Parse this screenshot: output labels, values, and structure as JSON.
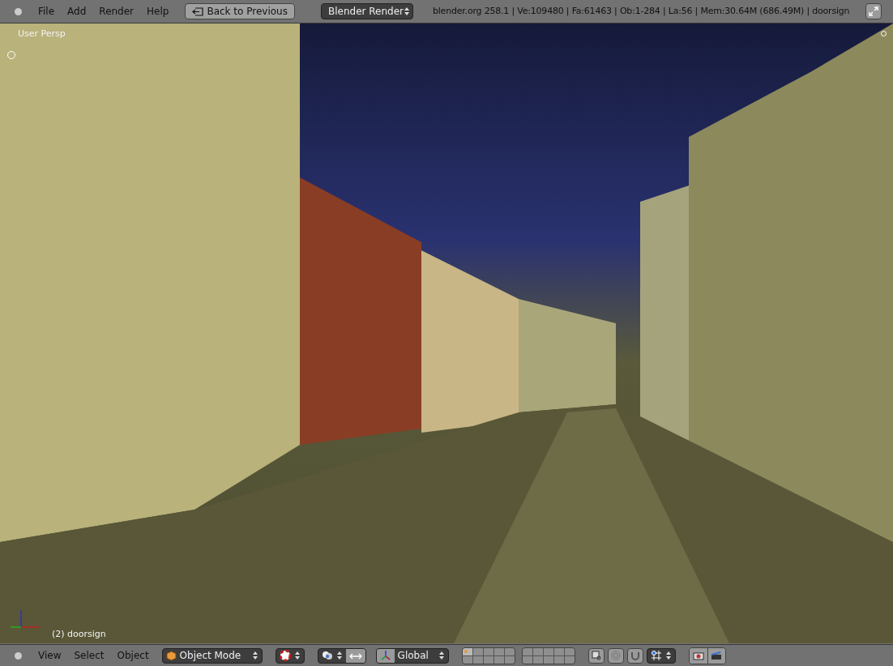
{
  "top_menu": [
    "File",
    "Add",
    "Render",
    "Help"
  ],
  "back_button": "Back to Previous",
  "render_engine": "Blender Render",
  "stats": "blender.org 258.1 | Ve:109480 | Fa:61463 | Ob:1-284 | La:56 | Mem:30.64M (686.49M) | doorsign",
  "viewport": {
    "view_name": "User Persp",
    "object_label": "(2) doorsign"
  },
  "bottom_menu": [
    "View",
    "Select",
    "Object"
  ],
  "mode": "Object Mode",
  "orientation": "Global",
  "layers": [
    {
      "selected": true
    },
    {
      "selected": false
    },
    {
      "selected": false
    },
    {
      "selected": false
    },
    {
      "selected": false
    },
    {
      "selected": false
    },
    {
      "selected": false
    },
    {
      "selected": false
    },
    {
      "selected": false
    },
    {
      "selected": false
    },
    {
      "selected": false
    },
    {
      "selected": false
    },
    {
      "selected": false
    },
    {
      "selected": false
    },
    {
      "selected": false
    },
    {
      "selected": false
    },
    {
      "selected": false
    },
    {
      "selected": false
    },
    {
      "selected": false
    },
    {
      "selected": false
    }
  ]
}
